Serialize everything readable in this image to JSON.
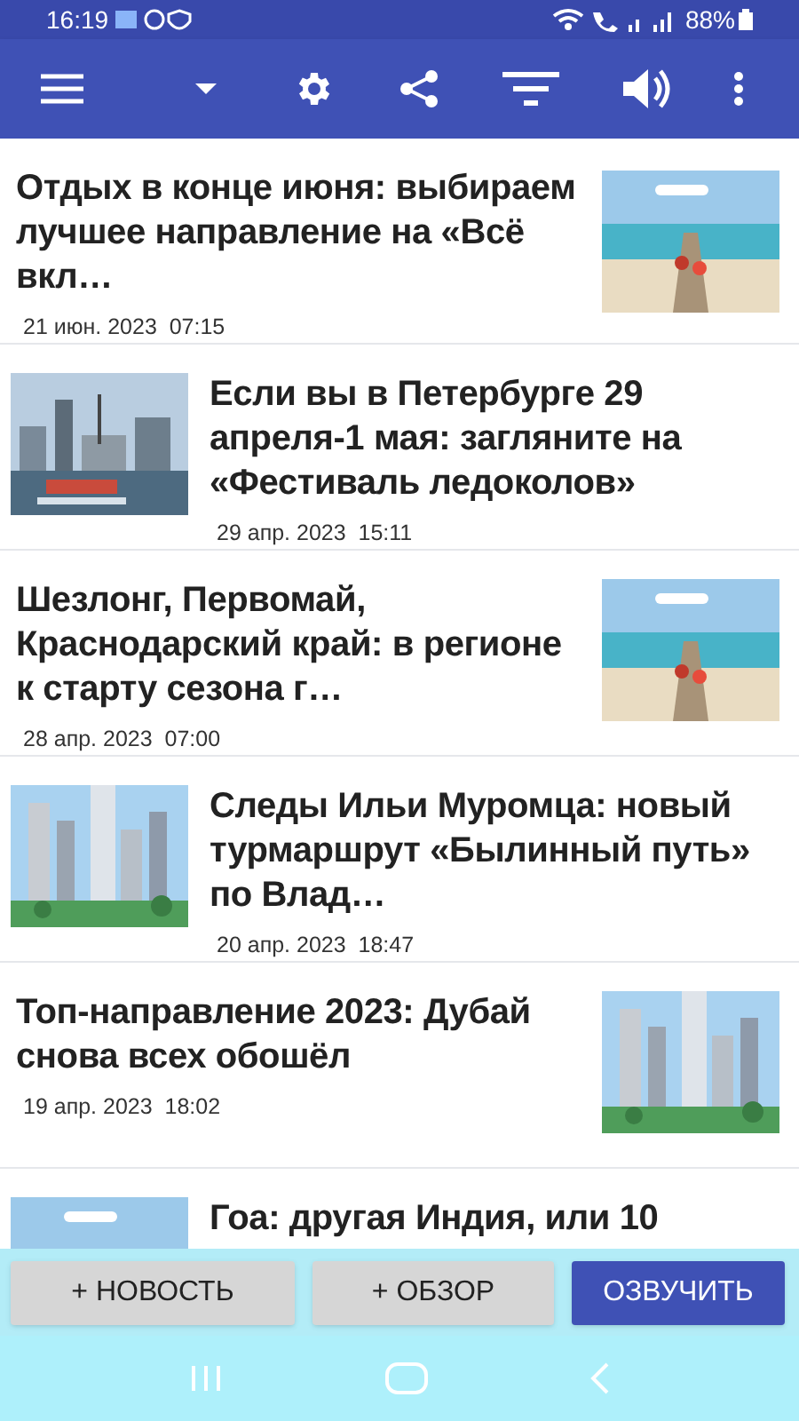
{
  "status_bar": {
    "time": "16:19",
    "battery": "88%"
  },
  "articles": [
    {
      "title": "Отдых в конце июня: выбираем лучшее направление на «Всё вкл…",
      "date": "21 июн. 2023  07:15",
      "kind": "thumb-right"
    },
    {
      "title": "Если вы в Петербурге 29 апреля-1 мая: загляните на «Фестиваль ледоколов»",
      "date": "29 апр. 2023  15:11",
      "kind": "thumb-left"
    },
    {
      "title": "Шезлонг, Первомай, Краснодарский край: в регионе к старту сезона г…",
      "date": "28 апр. 2023  07:00",
      "kind": "thumb-right"
    },
    {
      "title": "Следы Ильи Муромца: новый турмаршрут «Былинный путь» по Влад…",
      "date": "20 апр. 2023  18:47",
      "kind": "thumb-left"
    },
    {
      "title": "Топ-направление 2023: Дубай снова всех обошёл",
      "date": "19 апр. 2023  18:02",
      "kind": "thumb-right"
    },
    {
      "title": "Гоа: другая Индия, или 10",
      "kind": "thumb-left"
    }
  ],
  "buttons": [
    {
      "label": "+ НОВОСТЬ",
      "kind": "secondary"
    },
    {
      "label": "+ ОБЗОР",
      "kind": "secondary"
    },
    {
      "label": "ОЗВУЧИТЬ",
      "kind": "primary"
    }
  ]
}
